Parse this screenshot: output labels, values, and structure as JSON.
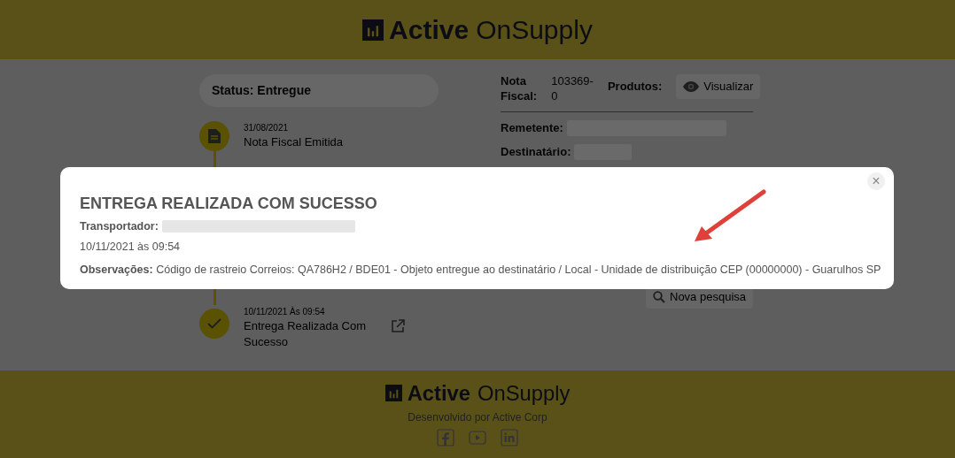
{
  "header": {
    "logo_bold": "Active",
    "logo_light": "OnSupply"
  },
  "status": {
    "label": "Status: Entregue"
  },
  "timeline": [
    {
      "date": "31/08/2021",
      "label": "Nota Fiscal Emitida",
      "kind": "document",
      "has_link": false
    },
    {
      "date": "10/11/2021 Às 09:54",
      "label": "Entrega Realizada Com Sucesso",
      "kind": "check",
      "has_link": true
    }
  ],
  "invoice": {
    "label": "Nota Fiscal:",
    "value": "103369-0"
  },
  "products": {
    "label": "Produtos:",
    "button": "Visualizar"
  },
  "parties": [
    {
      "label": "Remetente:"
    },
    {
      "label": "Destinatário:"
    }
  ],
  "new_search": {
    "button": "Nova pesquisa"
  },
  "modal": {
    "title": "ENTREGA REALIZADA COM SUCESSO",
    "carrier_label": "Transportador:",
    "datetime": "10/11/2021 às 09:54",
    "notes": "**Observações:** Código de rastreio Correios: QA786H2 / BDE01 - Objeto entregue ao destinatário / Local - Unidade de distribuição CEP (00000000) - Guarulhos SP",
    "close": "×"
  },
  "footer": {
    "logo_bold": "Active",
    "logo_light": "OnSupply",
    "credit": "Desenvolvido por Active Corp",
    "social": [
      {
        "kind": "facebook"
      },
      {
        "kind": "youtube"
      },
      {
        "kind": "linkedin"
      }
    ]
  }
}
